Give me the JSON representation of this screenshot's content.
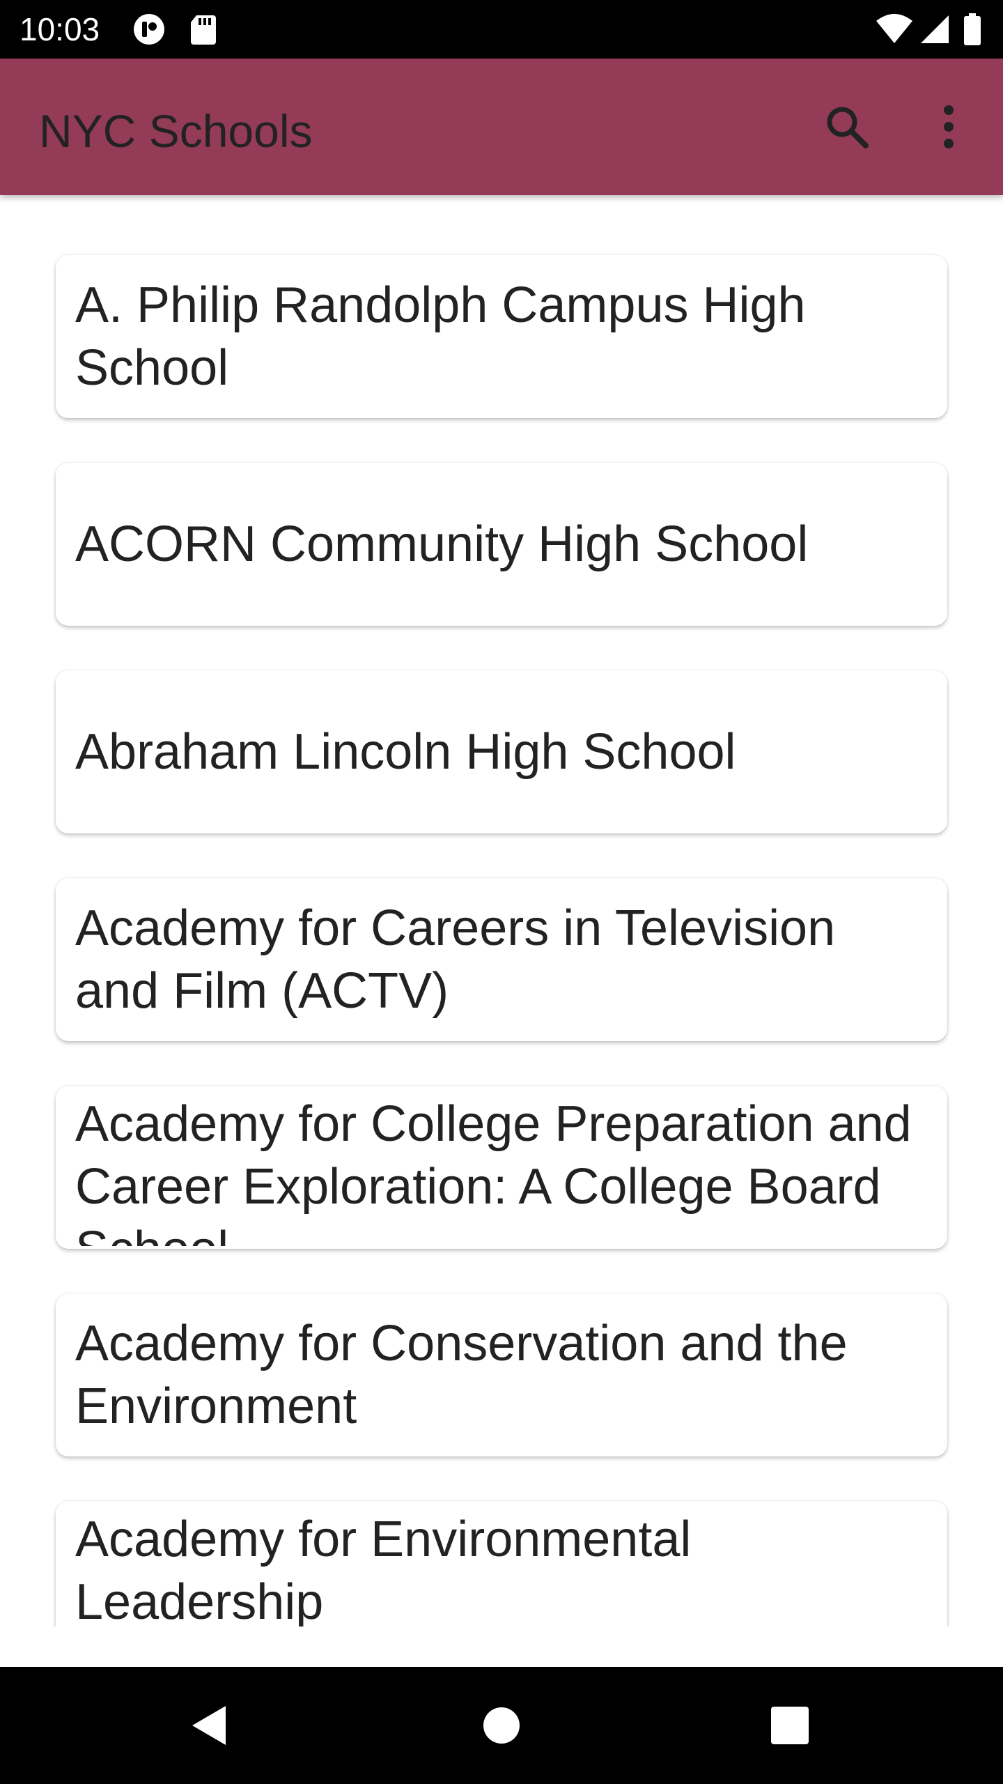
{
  "status_bar": {
    "time": "10:03",
    "icons": [
      "app-notification-icon",
      "sd-card-icon",
      "wifi-icon",
      "cellular-signal-icon",
      "battery-icon"
    ]
  },
  "app_bar": {
    "title": "NYC Schools",
    "background_color": "#943B58",
    "actions": [
      "search-icon",
      "more-vert-icon"
    ]
  },
  "schools": [
    "A. Philip Randolph Campus High School",
    "ACORN Community High School",
    "Abraham Lincoln High School",
    "Academy for Careers in Television and Film (ACTV)",
    "Academy for College Preparation and Career Exploration: A College Board School",
    "Academy for Conservation and the Environment",
    "Academy for Environmental Leadership"
  ],
  "nav_bar": {
    "buttons": [
      "back-icon",
      "home-icon",
      "recents-icon"
    ]
  }
}
